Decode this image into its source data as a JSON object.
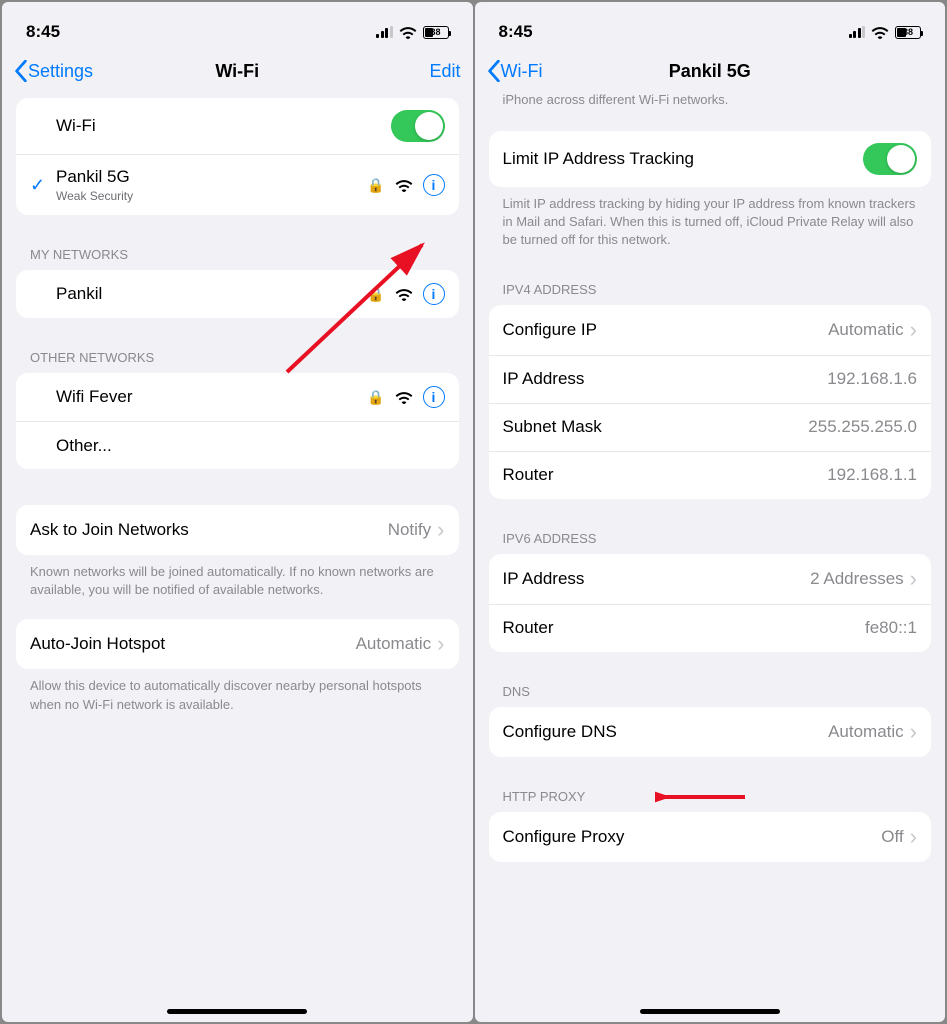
{
  "left": {
    "status": {
      "time": "8:45",
      "battery": "38"
    },
    "nav": {
      "back": "Settings",
      "title": "Wi-Fi",
      "edit": "Edit"
    },
    "wifi_toggle_label": "Wi-Fi",
    "connected": {
      "name": "Pankil 5G",
      "sub": "Weak Security"
    },
    "my_networks_header": "MY NETWORKS",
    "my_networks": [
      {
        "name": "Pankil"
      }
    ],
    "other_header": "OTHER NETWORKS",
    "other_networks": [
      {
        "name": "Wifi Fever"
      }
    ],
    "other_label": "Other...",
    "ask": {
      "label": "Ask to Join Networks",
      "value": "Notify",
      "footer": "Known networks will be joined automatically. If no known networks are available, you will be notified of available networks."
    },
    "auto": {
      "label": "Auto-Join Hotspot",
      "value": "Automatic",
      "footer": "Allow this device to automatically discover nearby personal hotspots when no Wi-Fi network is available."
    }
  },
  "right": {
    "status": {
      "time": "8:45",
      "battery": "38"
    },
    "nav": {
      "back": "Wi-Fi",
      "title": "Pankil 5G"
    },
    "top_trailing_text": "iPhone across different Wi-Fi networks.",
    "limit": {
      "label": "Limit IP Address Tracking",
      "footer": "Limit IP address tracking by hiding your IP address from known trackers in Mail and Safari. When this is turned off, iCloud Private Relay will also be turned off for this network."
    },
    "ipv4_header": "IPV4 ADDRESS",
    "ipv4": {
      "configure": {
        "label": "Configure IP",
        "value": "Automatic"
      },
      "ip": {
        "label": "IP Address",
        "value": "192.168.1.6"
      },
      "mask": {
        "label": "Subnet Mask",
        "value": "255.255.255.0"
      },
      "router": {
        "label": "Router",
        "value": "192.168.1.1"
      }
    },
    "ipv6_header": "IPV6 ADDRESS",
    "ipv6": {
      "ip": {
        "label": "IP Address",
        "value": "2 Addresses"
      },
      "router": {
        "label": "Router",
        "value": "fe80::1"
      }
    },
    "dns_header": "DNS",
    "dns": {
      "label": "Configure DNS",
      "value": "Automatic"
    },
    "proxy_header": "HTTP PROXY",
    "proxy": {
      "label": "Configure Proxy",
      "value": "Off"
    }
  }
}
